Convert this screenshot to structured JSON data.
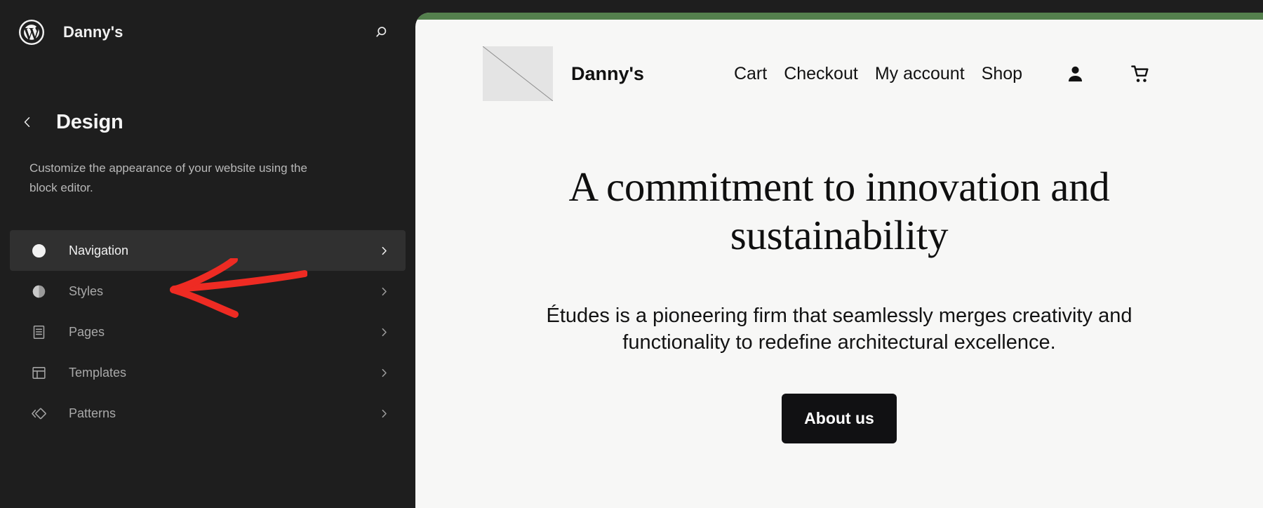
{
  "editor": {
    "logo_icon": "wordpress-logo-icon",
    "site_title": "Danny's",
    "search_icon": "search-icon",
    "back_icon": "chevron-left-icon",
    "panel_heading": "Design",
    "panel_description": "Customize the appearance of your website using the block editor.",
    "nav_items": [
      {
        "label": "Navigation",
        "icon": "compass-icon",
        "active": true,
        "chevron": "chevron-right-icon"
      },
      {
        "label": "Styles",
        "icon": "contrast-icon",
        "active": false,
        "chevron": "chevron-right-icon"
      },
      {
        "label": "Pages",
        "icon": "page-icon",
        "active": false,
        "chevron": "chevron-right-icon"
      },
      {
        "label": "Templates",
        "icon": "layout-icon",
        "active": false,
        "chevron": "chevron-right-icon"
      },
      {
        "label": "Patterns",
        "icon": "pattern-icon",
        "active": false,
        "chevron": "chevron-right-icon"
      }
    ]
  },
  "preview": {
    "accent_bar_color": "#54804d",
    "background_color": "#f7f7f6",
    "site_logo_icon": "image-placeholder-icon",
    "site_brand": "Danny's",
    "menu": [
      {
        "label": "Cart"
      },
      {
        "label": "Checkout"
      },
      {
        "label": "My account"
      },
      {
        "label": "Shop"
      }
    ],
    "account_icon": "user-icon",
    "cart_icon": "shopping-cart-icon",
    "hero": {
      "heading": "A commitment to innovation and sustainability",
      "paragraph": "Études is a pioneering firm that seamlessly merges creativity and functionality to redefine architectural excellence.",
      "button_label": "About us",
      "button_color": "#111113"
    }
  },
  "annotation": {
    "type": "arrow",
    "color": "#ee2b23",
    "points_to": "Navigation"
  }
}
